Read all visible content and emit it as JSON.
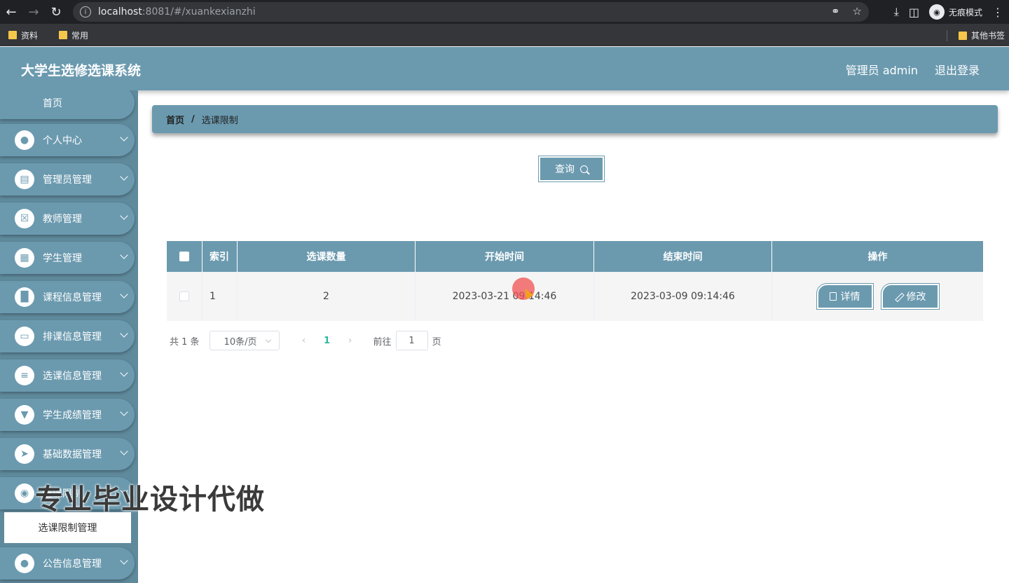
{
  "browser": {
    "url_host": "localhost",
    "url_rest": ":8081/#/xuankexianzhi",
    "incognito_label": "无痕模式",
    "bookmarks": [
      "资料",
      "常用"
    ],
    "other_bookmarks": "其他书签"
  },
  "header": {
    "title": "大学生选修选课系统",
    "user_label": "管理员 admin",
    "logout_label": "退出登录"
  },
  "sidebar": {
    "home": "首页",
    "items": [
      {
        "label": "个人中心",
        "icon": "user-icon"
      },
      {
        "label": "管理员管理",
        "icon": "clipboard-icon"
      },
      {
        "label": "教师管理",
        "icon": "clipboard-x-icon"
      },
      {
        "label": "学生管理",
        "icon": "grid-icon"
      },
      {
        "label": "课程信息管理",
        "icon": "bar-chart-icon"
      },
      {
        "label": "排课信息管理",
        "icon": "monitor-icon"
      },
      {
        "label": "选课信息管理",
        "icon": "sliders-icon"
      },
      {
        "label": "学生成绩管理",
        "icon": "signpost-icon"
      },
      {
        "label": "基础数据管理",
        "icon": "send-icon"
      },
      {
        "label": "选课限制",
        "icon": "lightbulb-icon"
      },
      {
        "label": "公告信息管理",
        "icon": "user-icon"
      }
    ],
    "active_sub": "选课限制管理"
  },
  "breadcrumb": {
    "home": "首页",
    "separator": "/",
    "current": "选课限制"
  },
  "search": {
    "button_label": "查询"
  },
  "table": {
    "headers": [
      "索引",
      "选课数量",
      "开始时间",
      "结束时间",
      "操作"
    ],
    "rows": [
      {
        "index": "1",
        "count": "2",
        "start": "2023-03-21 09:14:46",
        "end": "2023-03-09 09:14:46"
      }
    ],
    "detail_label": "详情",
    "edit_label": "修改"
  },
  "pagination": {
    "total": "共 1 条",
    "page_size": "10条/页",
    "current_page": "1",
    "goto_label": "前往",
    "goto_value": "1",
    "page_suffix": "页"
  },
  "watermark": "专业毕业设计代做",
  "colors": {
    "primary": "#6b9aaf",
    "sidebar_bg": "#5f8a9c",
    "active_page": "#2eb89a"
  }
}
